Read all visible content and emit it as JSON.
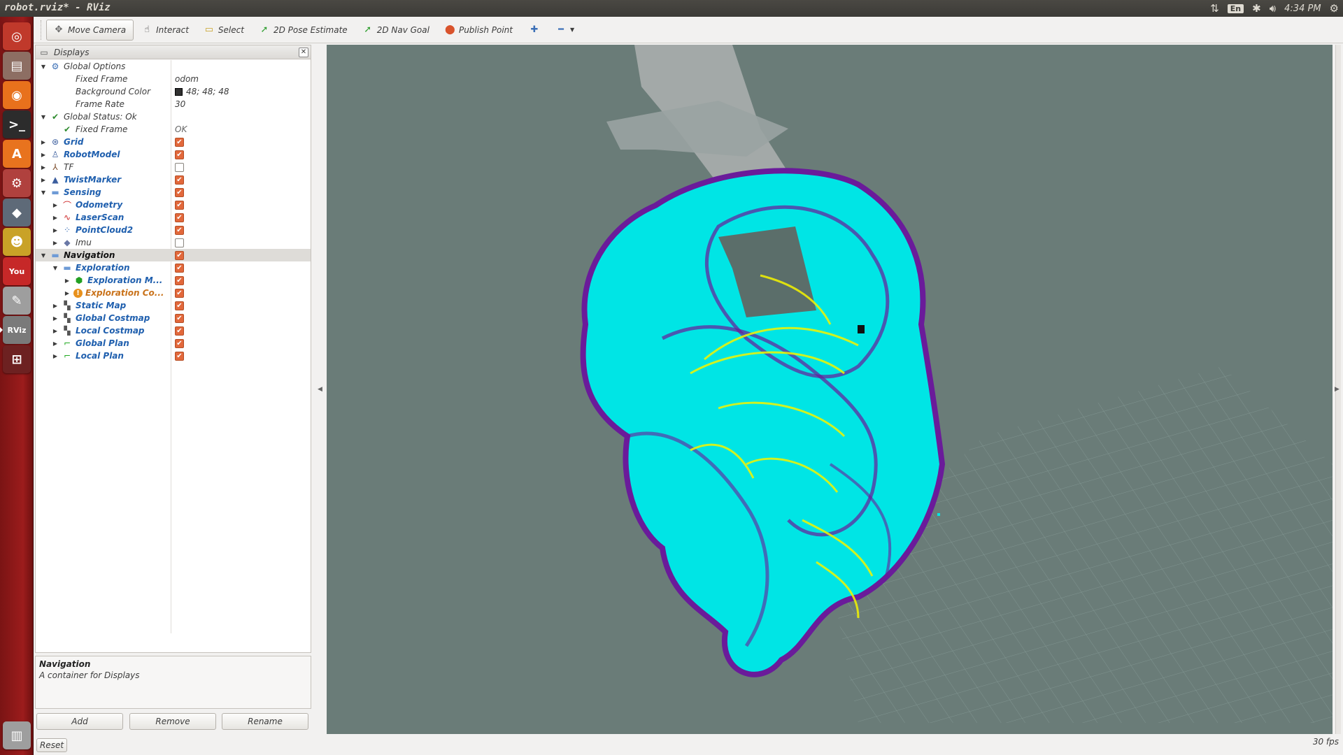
{
  "window": {
    "title": "robot.rviz* - RViz"
  },
  "tray": {
    "keyboard": "En",
    "clock": "4:34 PM"
  },
  "launcher": {
    "items": [
      {
        "name": "ubuntu-dash-icon",
        "glyph": "◎",
        "color": "#c0392b"
      },
      {
        "name": "files-icon",
        "glyph": "▤",
        "color": "#8d6e63"
      },
      {
        "name": "firefox-icon",
        "glyph": "◉",
        "color": "#e8711c"
      },
      {
        "name": "terminal-icon",
        "glyph": ">_",
        "color": "#2c2c2c"
      },
      {
        "name": "software-center-icon",
        "glyph": "A",
        "color": "#e8731e"
      },
      {
        "name": "system-settings-icon",
        "glyph": "⚙",
        "color": "#b0413e"
      },
      {
        "name": "gazebo-icon",
        "glyph": "◆",
        "color": "#5e6a78"
      },
      {
        "name": "gimp-icon",
        "glyph": "☻",
        "color": "#c9a227"
      },
      {
        "name": "youtube-icon",
        "glyph": "You",
        "color": "#c62828"
      },
      {
        "name": "text-editor-icon",
        "glyph": "✎",
        "color": "#9e9e9e"
      },
      {
        "name": "rviz-icon",
        "glyph": "RViz",
        "color": "#7a7a7a"
      },
      {
        "name": "workspace-switcher-icon",
        "glyph": "⊞",
        "color": "#6d2121"
      },
      {
        "name": "trash-icon",
        "glyph": "▥",
        "color": "#9e9e9e"
      }
    ]
  },
  "toolbar": {
    "tools": [
      {
        "name": "move-camera-tool",
        "label": "Move Camera",
        "icon": "✥",
        "icon_color": "#666666",
        "active": true
      },
      {
        "name": "interact-tool",
        "label": "Interact",
        "icon": "☝",
        "icon_color": "#444444"
      },
      {
        "name": "select-tool",
        "label": "Select",
        "icon": "▭",
        "icon_color": "#c9a227"
      },
      {
        "name": "2d-pose-estimate-tool",
        "label": "2D Pose Estimate",
        "icon": "➚",
        "icon_color": "#2e9e2e"
      },
      {
        "name": "2d-nav-goal-tool",
        "label": "2D Nav Goal",
        "icon": "➚",
        "icon_color": "#2e9e2e"
      },
      {
        "name": "publish-point-tool",
        "label": "Publish Point",
        "icon": "⬤",
        "icon_color": "#d9532c"
      }
    ],
    "add_tool_icon": "✚",
    "remove_tool_icon": "━"
  },
  "displays": {
    "title": "Displays",
    "rows": [
      {
        "depth": 0,
        "arrow": "▼",
        "icon": "⚙",
        "icon_color": "#3b6fb6",
        "label": "Global Options",
        "style": "plain"
      },
      {
        "depth": 1,
        "arrow": "",
        "icon": "",
        "label": "Fixed Frame",
        "style": "plain",
        "value": "odom"
      },
      {
        "depth": 1,
        "arrow": "",
        "icon": "",
        "label": "Background Color",
        "style": "plain",
        "value": "48; 48; 48",
        "swatch": "#303030"
      },
      {
        "depth": 1,
        "arrow": "",
        "icon": "",
        "label": "Frame Rate",
        "style": "plain",
        "value": "30"
      },
      {
        "depth": 0,
        "arrow": "▼",
        "icon": "✔",
        "icon_color": "#2e8b2e",
        "label": "Global Status: Ok",
        "style": "plain"
      },
      {
        "depth": 1,
        "arrow": "",
        "icon": "✔",
        "icon_color": "#2e8b2e",
        "label": "Fixed Frame",
        "style": "plain",
        "value": "OK"
      },
      {
        "depth": 0,
        "arrow": "▶",
        "icon": "⊛",
        "icon_color": "#3b5e9e",
        "label": "Grid",
        "style": "disp",
        "checked": true
      },
      {
        "depth": 0,
        "arrow": "▶",
        "icon": "♙",
        "icon_color": "#3b5e9e",
        "label": "RobotModel",
        "style": "disp",
        "checked": true
      },
      {
        "depth": 0,
        "arrow": "▶",
        "icon": "⅄",
        "icon_color": "#7b4b2a",
        "label": "TF",
        "style": "plain",
        "checked": false
      },
      {
        "depth": 0,
        "arrow": "▶",
        "icon": "▲",
        "icon_color": "#3b5e9e",
        "label": "TwistMarker",
        "style": "disp",
        "checked": true
      },
      {
        "depth": 0,
        "arrow": "▼",
        "icon": "▬",
        "icon_color": "#6e9bd6",
        "label": "Sensing",
        "style": "disp",
        "checked": true
      },
      {
        "depth": 1,
        "arrow": "▶",
        "icon": "⌒",
        "icon_color": "#cc2222",
        "label": "Odometry",
        "style": "disp",
        "checked": true
      },
      {
        "depth": 1,
        "arrow": "▶",
        "icon": "∿",
        "icon_color": "#cc2222",
        "label": "LaserScan",
        "style": "disp",
        "checked": true
      },
      {
        "depth": 1,
        "arrow": "▶",
        "icon": "⁘",
        "icon_color": "#3b6fb6",
        "label": "PointCloud2",
        "style": "disp",
        "checked": true
      },
      {
        "depth": 1,
        "arrow": "▶",
        "icon": "◆",
        "icon_color": "#6a78a6",
        "label": "Imu",
        "style": "plain",
        "checked": false
      },
      {
        "depth": 0,
        "arrow": "▼",
        "icon": "▬",
        "icon_color": "#6e9bd6",
        "label": "Navigation",
        "style": "grp",
        "checked": true,
        "selected": true
      },
      {
        "depth": 1,
        "arrow": "▼",
        "icon": "▬",
        "icon_color": "#6e9bd6",
        "label": "Exploration",
        "style": "disp",
        "checked": true
      },
      {
        "depth": 2,
        "arrow": "▶",
        "icon": "⬢",
        "icon_color": "#22a022",
        "label": "Exploration M...",
        "style": "disp",
        "checked": true
      },
      {
        "depth": 2,
        "arrow": "▶",
        "icon": "!",
        "icon_color": "#e8911c",
        "label": "Exploration Co...",
        "style": "warn",
        "checked": true
      },
      {
        "depth": 1,
        "arrow": "▶",
        "icon": "▚",
        "icon_color": "#555555",
        "label": "Static Map",
        "style": "disp",
        "checked": true
      },
      {
        "depth": 1,
        "arrow": "▶",
        "icon": "▚",
        "icon_color": "#555555",
        "label": "Global Costmap",
        "style": "disp",
        "checked": true
      },
      {
        "depth": 1,
        "arrow": "▶",
        "icon": "▚",
        "icon_color": "#555555",
        "label": "Local Costmap",
        "style": "disp",
        "checked": true
      },
      {
        "depth": 1,
        "arrow": "▶",
        "icon": "⌐",
        "icon_color": "#22aa22",
        "label": "Global Plan",
        "style": "disp",
        "checked": true
      },
      {
        "depth": 1,
        "arrow": "▶",
        "icon": "⌐",
        "icon_color": "#22aa22",
        "label": "Local Plan",
        "style": "disp",
        "checked": true
      }
    ]
  },
  "description": {
    "title": "Navigation",
    "text": "A container for Displays"
  },
  "buttons": {
    "add": "Add",
    "remove": "Remove",
    "rename": "Rename",
    "reset": "Reset"
  },
  "status": {
    "fps": "30 fps"
  },
  "colors": {
    "background": "#303030",
    "costmap_inflation": "#00e5e5",
    "costmap_lethal": "#6a1b9a",
    "laser": "#f5f500",
    "map_free": "#b8b8b8"
  }
}
